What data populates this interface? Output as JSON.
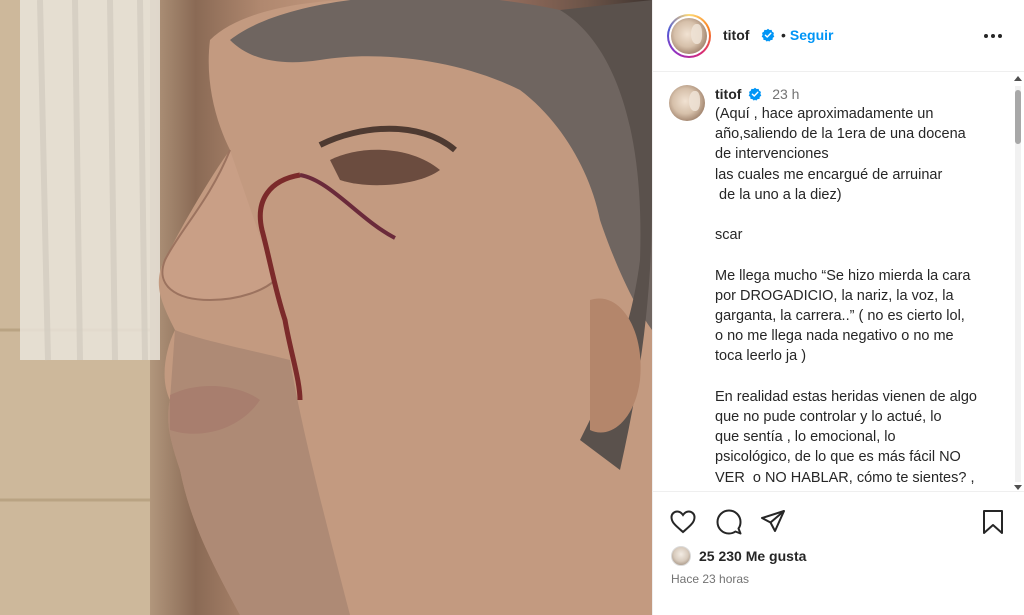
{
  "post": {
    "username": "titof",
    "follow_label": "Seguir",
    "follow_separator": "•",
    "more_icon": "more-horizontal-icon"
  },
  "caption": {
    "username": "titof",
    "time": "23 h",
    "text": "(Aquí , hace aproximadamente un\naño,saliendo de la 1era de una docena\nde intervenciones\nlas cuales me encargué de arruinar\n de la uno a la diez)\n\nscar\n\nMe llega mucho “Se hizo mierda la cara\npor DROGADICIO, la nariz, la voz, la\ngarganta, la carrera..” ( no es cierto lol,\no no me llega nada negativo o no me\ntoca leerlo ja )\n\nEn realidad estas heridas vienen de algo\nque no pude controlar y lo actué, lo\nque sentía , lo emocional, lo\npsicológico, de lo que es más fácil NO\nVER  o NO HABLAR, cómo te sientes? ,\n¿cómo estas?"
  },
  "actions": {
    "icons": [
      "heart-icon",
      "comment-icon",
      "share-icon",
      "bookmark-icon"
    ],
    "likes_text": "25 230 Me gusta",
    "time_ago": "Hace 23 horas"
  },
  "colors": {
    "accent": "#0095f6",
    "verified": "#0095f6",
    "text": "#262626",
    "secondary": "#737373"
  }
}
